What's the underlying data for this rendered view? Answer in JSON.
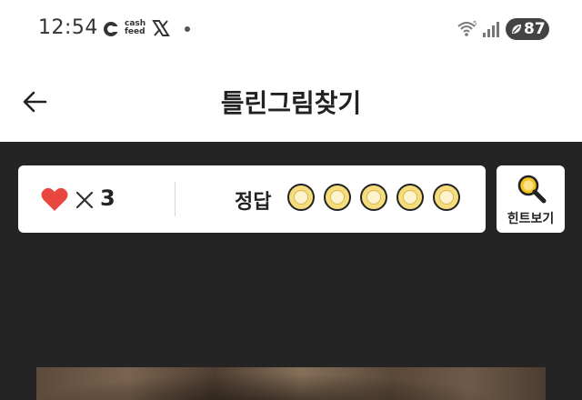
{
  "status_bar": {
    "time": "12:54",
    "cashfeed_logo_text": "cash\nfeed",
    "battery_level": "87",
    "icons": [
      "cashfeed-icon",
      "x-logo-icon",
      "notification-dot-icon",
      "wifi-icon",
      "signal-icon",
      "battery-icon"
    ]
  },
  "header": {
    "title": "틀린그림찾기",
    "back_icon": "back-arrow-icon"
  },
  "game": {
    "lives": {
      "icon": "heart-icon",
      "multiplier_symbol": "×",
      "count": "3"
    },
    "answer": {
      "label": "정답",
      "total_slots": 5,
      "found": 0
    },
    "hint_button": {
      "label": "힌트보기",
      "icon": "magnifier-icon"
    }
  },
  "colors": {
    "game_background": "#242424",
    "panel_background": "#ffffff",
    "heart": "#e8473f",
    "slot_fill": "#f5dd7e",
    "magnifier_accent": "#f2c523"
  }
}
